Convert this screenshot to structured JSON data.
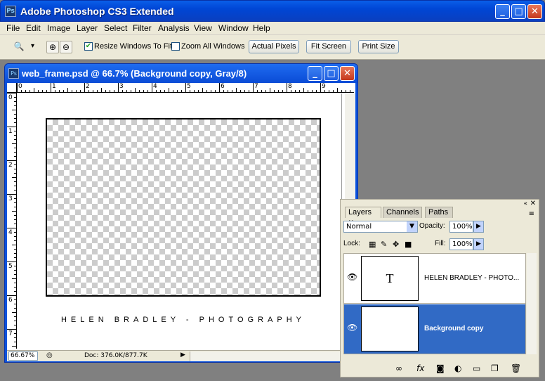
{
  "app": {
    "title": "Adobe Photoshop CS3 Extended",
    "icon": "ps-icon"
  },
  "window_controls": {
    "minimize": "_",
    "maximize": "□",
    "close": "✕"
  },
  "menu": [
    "File",
    "Edit",
    "Image",
    "Layer",
    "Select",
    "Filter",
    "Analysis",
    "View",
    "Window",
    "Help"
  ],
  "options": {
    "tool": "zoom-tool",
    "dropdown_arrow": "▾",
    "zoom_in": "⊕",
    "zoom_out": "⊖",
    "resize_windows": {
      "label": "Resize Windows To Fit",
      "checked": true
    },
    "zoom_all": {
      "label": "Zoom All Windows",
      "checked": false
    },
    "actual_pixels": "Actual Pixels",
    "fit_screen": "Fit Screen",
    "print_size": "Print Size"
  },
  "document": {
    "title": "web_frame.psd @ 66.7% (Background copy, Gray/8)",
    "ruler_h": [
      "0",
      "1",
      "2",
      "3",
      "4",
      "5",
      "6",
      "7",
      "8",
      "9"
    ],
    "ruler_v": [
      "0",
      "1",
      "2",
      "3",
      "4",
      "5",
      "6",
      "7"
    ],
    "credit": "HELEN BRADLEY - PHOTOGRAPHY",
    "status": {
      "zoom": "66.67%",
      "doc": "Doc: 376.0K/877.7K"
    }
  },
  "layers_panel": {
    "tabs": [
      "Layers",
      "Channels",
      "Paths"
    ],
    "blend_mode": "Normal",
    "opacity_label": "Opacity:",
    "opacity": "100%",
    "lock_label": "Lock:",
    "fill_label": "Fill:",
    "fill": "100%",
    "layers": [
      {
        "name": "HELEN BRADLEY - PHOTO...",
        "thumb": "T",
        "selected": false
      },
      {
        "name": "Background copy",
        "selected": true
      }
    ],
    "footer_icons": [
      "link-icon",
      "fx-icon",
      "mask-icon",
      "adjustment-icon",
      "folder-icon",
      "new-layer-icon",
      "trash-icon"
    ]
  },
  "colors": {
    "xp_blue": "#0a52dd",
    "selected": "#316ac5",
    "panel": "#ece9d8",
    "workspace": "#808080"
  }
}
